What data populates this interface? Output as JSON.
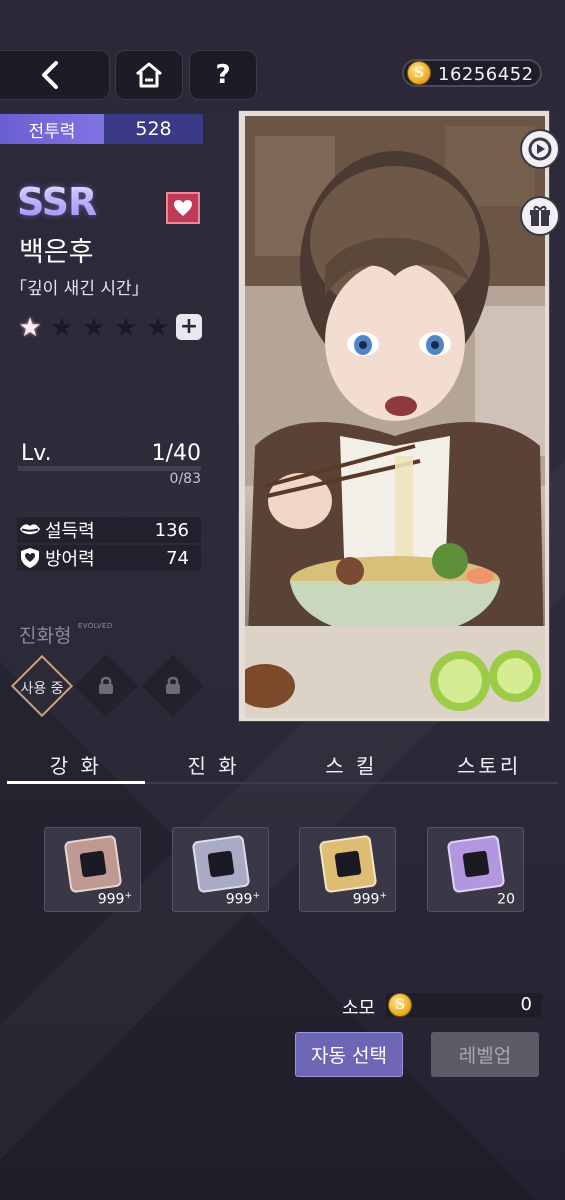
{
  "header": {
    "back_label": "<",
    "help_label": "?",
    "currency_amount": "16256452"
  },
  "power": {
    "label": "전투력",
    "value": "528"
  },
  "card": {
    "rarity": "SSR",
    "name": "백은후",
    "title": "「깊이 새긴 시간」",
    "stars_filled": 1,
    "stars_total": 5,
    "plus_label": "+"
  },
  "level": {
    "label": "Lv.",
    "value": "1/40",
    "exp": "0/83",
    "progress": 0
  },
  "stats": [
    {
      "name": "설득력",
      "value": "136",
      "icon": "lips-icon"
    },
    {
      "name": "방어력",
      "value": "74",
      "icon": "shield-heart-icon"
    }
  ],
  "evolution": {
    "label": "진화형",
    "sublabel": "EVOLVED",
    "in_use_label": "사용 중"
  },
  "tabs": [
    {
      "label": "강 화",
      "active": true
    },
    {
      "label": "진 화",
      "active": false
    },
    {
      "label": "스 킬",
      "active": false
    },
    {
      "label": "스토리",
      "active": false
    }
  ],
  "items": [
    {
      "count": "999",
      "sup": "+",
      "color": "#b88f8a"
    },
    {
      "count": "999",
      "sup": "+",
      "color": "#9ea0bf"
    },
    {
      "count": "999",
      "sup": "+",
      "color": "#d8b76c"
    },
    {
      "count": "20",
      "sup": "",
      "color": "#a98ad8"
    }
  ],
  "cost": {
    "label": "소모",
    "value": "0"
  },
  "buttons": {
    "auto_select": "자동 선택",
    "level_up": "레벨업"
  },
  "colors": {
    "accent": "#6c66b5",
    "power_bg": "#3b3a86",
    "heart_badge": "#c03a55"
  }
}
